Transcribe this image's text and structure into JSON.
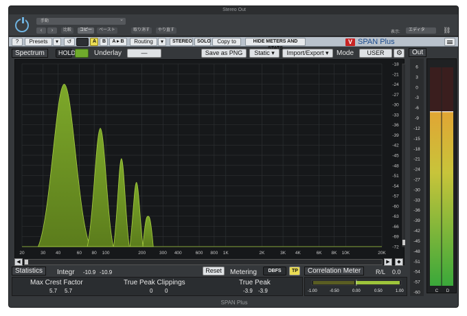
{
  "window": {
    "title": "Stereo Out",
    "footer": "SPAN Plus"
  },
  "host": {
    "preset_value": "手動",
    "compare": "比較",
    "copy": "コピー",
    "paste": "ペースト",
    "undo": "取り消す",
    "redo": "やり直す",
    "view_label": "表示:",
    "view_value": "エディタ"
  },
  "toolbar": {
    "help": "?",
    "presets": "Presets",
    "undo": "↺",
    "a": "A",
    "b": "B",
    "ab": "A ▸ B",
    "routing": "Routing",
    "stereo": "STEREO",
    "solo": "SOLO",
    "copy_to": "Copy to",
    "hide": "HIDE METERS AND STATS",
    "logo_letter": "V",
    "brand": "SPAN Plus"
  },
  "spectrum_header": {
    "title": "Spectrum",
    "hold": "HOLD",
    "underlay": "Underlay",
    "underlay_value": "—",
    "save": "Save as PNG",
    "static": "Static ▾",
    "import_export": "Import/Export ▾",
    "mode_label": "Mode",
    "mode_value": "USER"
  },
  "out": {
    "title": "Out",
    "level_db": -7,
    "peak_db": -7
  },
  "statistics": {
    "title": "Statistics",
    "integr_label": "Integr",
    "integr_left": "-10.9",
    "integr_right": "-10.9",
    "reset": "Reset",
    "metering_label": "Metering",
    "metering_value": "DBFS",
    "tp": "TP",
    "max_crest_label": "Max Crest Factor",
    "max_crest_left": "5.7",
    "max_crest_right": "5.7",
    "tp_clip_label": "True Peak Clippings",
    "tp_clip_left": "0",
    "tp_clip_right": "0",
    "true_peak_label": "True Peak",
    "true_peak_left": "-3.9",
    "true_peak_right": "-3.9"
  },
  "correlation": {
    "title": "Correlation Meter",
    "rl": "R/L",
    "value": "0.0",
    "scale": [
      "-1.00",
      "-0.50",
      "0.00",
      "0.50",
      "1.00"
    ]
  },
  "colors": {
    "accent_green": "#8db832",
    "toolbar_blue": "#b9c2cc",
    "brand_red": "#c82424"
  },
  "chart_data": {
    "type": "area",
    "x_ticks": [
      "20",
      "30",
      "40",
      "60",
      "80",
      "100",
      "200",
      "300",
      "400",
      "600",
      "800",
      "1K",
      "2K",
      "3K",
      "4K",
      "6K",
      "8K",
      "10K",
      "20K"
    ],
    "y_ticks": [
      "-18",
      "-21",
      "-24",
      "-27",
      "-30",
      "-33",
      "-36",
      "-39",
      "-42",
      "-45",
      "-48",
      "-51",
      "-54",
      "-57",
      "-60",
      "-63",
      "-66",
      "-69",
      "-72"
    ],
    "xlim": [
      20,
      20000
    ],
    "ylim": [
      -72,
      -18
    ],
    "x_scale": "log",
    "grid": true,
    "peaks": [
      {
        "freq": 45,
        "db": -24
      },
      {
        "freq": 90,
        "db": -37
      },
      {
        "freq": 135,
        "db": -46
      },
      {
        "freq": 180,
        "db": -53
      },
      {
        "freq": 225,
        "db": -63
      }
    ]
  },
  "meter": {
    "scale": [
      "6",
      "3",
      "0",
      "-3",
      "-6",
      "-9",
      "-12",
      "-15",
      "-18",
      "-21",
      "-24",
      "-27",
      "-30",
      "-33",
      "-36",
      "-39",
      "-42",
      "-45",
      "-48",
      "-51",
      "-54",
      "-57",
      "-60"
    ],
    "channels": [
      "C",
      "D"
    ]
  }
}
